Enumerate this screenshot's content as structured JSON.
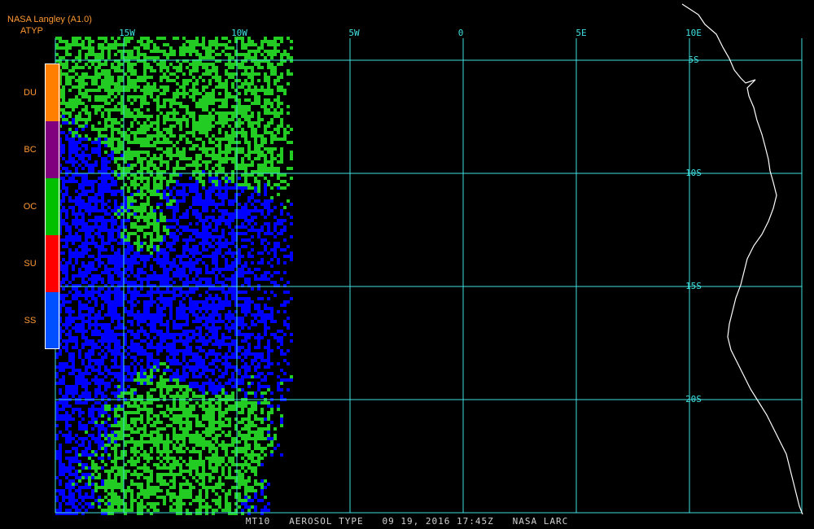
{
  "header": {
    "title": "NASA Langley (A1.0)",
    "product": "ATYP"
  },
  "legend": {
    "items": [
      {
        "code": "DU",
        "color": "#ff8000"
      },
      {
        "code": "BC",
        "color": "#800080"
      },
      {
        "code": "OC",
        "color": "#00c000"
      },
      {
        "code": "SU",
        "color": "#ff0000"
      },
      {
        "code": "SS",
        "color": "#0050ff"
      }
    ],
    "border_color": "#ffffff"
  },
  "map": {
    "longitude_labels": [
      "15W",
      "10W",
      "5W",
      "0",
      "5E",
      "10E"
    ],
    "latitude_labels": [
      "5S",
      "10S",
      "15S",
      "20S"
    ],
    "grid_color": "#40e0e0",
    "coastline_color": "#ffffff",
    "background_color": "#000000",
    "aerosol_colors": {
      "organic_carbon": "#22cc22",
      "sea_salt": "#0000ff"
    }
  },
  "footer": {
    "satellite": "MT10",
    "product_name": "AEROSOL TYPE",
    "datetime": "09 19, 2016 17:45Z",
    "source": "NASA LARC"
  }
}
